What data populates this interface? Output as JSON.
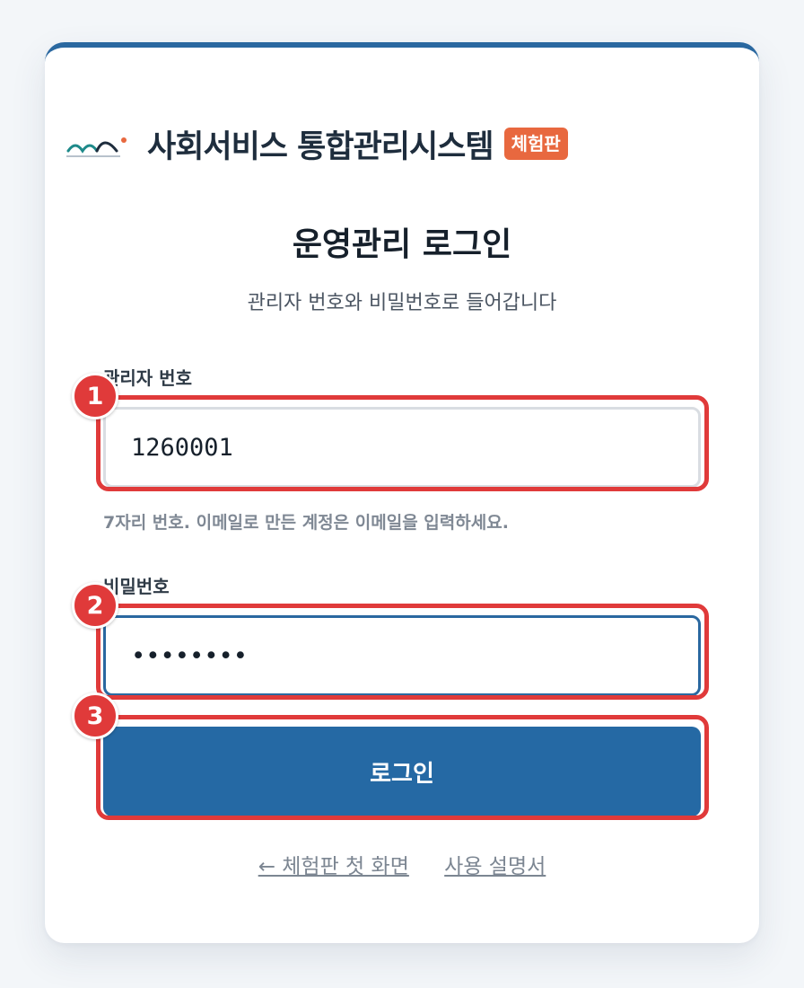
{
  "brand": {
    "name": "사회서비스 통합관리시스템",
    "badge": "체험판",
    "logo_colors": {
      "teal": "#1e8a8a",
      "navy": "#1e2d3d",
      "dot": "#e8683f"
    }
  },
  "login": {
    "title": "운영관리 로그인",
    "subtitle": "관리자 번호와 비밀번호로 들어갑니다",
    "id_label": "관리자 번호",
    "id_value": "1260001",
    "id_hint": "7자리 번호. 이메일로 만든 계정은 이메일을 입력하세요.",
    "password_label": "비밀번호",
    "password_value": "••••••••",
    "submit_label": "로그인"
  },
  "links": {
    "back": "← 체험판 첫 화면",
    "manual": "사용 설명서"
  },
  "annotations": {
    "marker_1": "1",
    "marker_2": "2",
    "marker_3": "3"
  },
  "colors": {
    "accent": "#2569a4",
    "badge": "#e8683f",
    "highlight": "#e03a3a"
  }
}
